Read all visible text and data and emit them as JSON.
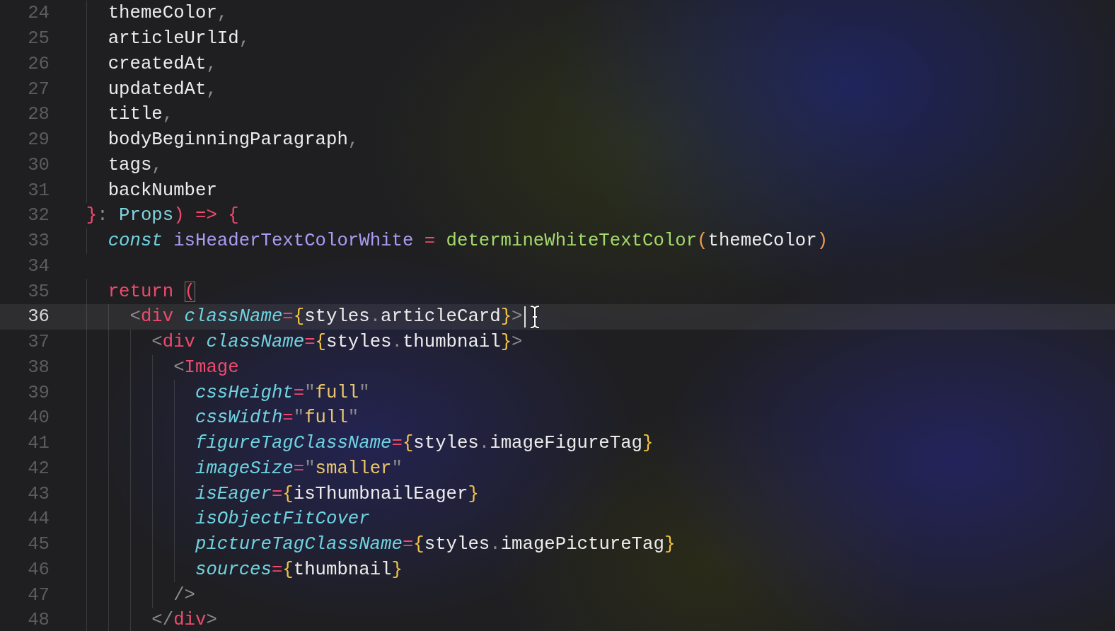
{
  "editor": {
    "lines": [
      {
        "number": "24",
        "current": false,
        "caret": false,
        "tokens": [
          {
            "text": "    themeColor",
            "kind": "plain"
          },
          {
            "text": ",",
            "kind": "punct"
          }
        ]
      },
      {
        "number": "25",
        "current": false,
        "caret": false,
        "tokens": [
          {
            "text": "    articleUrlId",
            "kind": "plain"
          },
          {
            "text": ",",
            "kind": "punct"
          }
        ]
      },
      {
        "number": "26",
        "current": false,
        "caret": false,
        "tokens": [
          {
            "text": "    createdAt",
            "kind": "plain"
          },
          {
            "text": ",",
            "kind": "punct"
          }
        ]
      },
      {
        "number": "27",
        "current": false,
        "caret": false,
        "tokens": [
          {
            "text": "    updatedAt",
            "kind": "plain"
          },
          {
            "text": ",",
            "kind": "punct"
          }
        ]
      },
      {
        "number": "28",
        "current": false,
        "caret": false,
        "tokens": [
          {
            "text": "    title",
            "kind": "plain"
          },
          {
            "text": ",",
            "kind": "punct"
          }
        ]
      },
      {
        "number": "29",
        "current": false,
        "caret": false,
        "tokens": [
          {
            "text": "    bodyBeginningParagraph",
            "kind": "plain"
          },
          {
            "text": ",",
            "kind": "punct"
          }
        ]
      },
      {
        "number": "30",
        "current": false,
        "caret": false,
        "tokens": [
          {
            "text": "    tags",
            "kind": "plain"
          },
          {
            "text": ",",
            "kind": "punct"
          }
        ]
      },
      {
        "number": "31",
        "current": false,
        "caret": false,
        "tokens": [
          {
            "text": "    backNumber",
            "kind": "plain"
          }
        ]
      },
      {
        "number": "32",
        "current": false,
        "caret": false,
        "tokens": [
          {
            "text": "  }",
            "kind": "keyword"
          },
          {
            "text": ":",
            "kind": "punct"
          },
          {
            "text": " Props",
            "kind": "type"
          },
          {
            "text": ") => {",
            "kind": "keyword"
          }
        ]
      },
      {
        "number": "33",
        "current": false,
        "caret": false,
        "tokens": [
          {
            "text": "    const",
            "kind": "storage"
          },
          {
            "text": " isHeaderTextColorWhite",
            "kind": "variable"
          },
          {
            "text": " = ",
            "kind": "keyword"
          },
          {
            "text": "determineWhiteTextColor",
            "kind": "function"
          },
          {
            "text": "(",
            "kind": "paren"
          },
          {
            "text": "themeColor",
            "kind": "plain"
          },
          {
            "text": ")",
            "kind": "paren"
          }
        ]
      },
      {
        "number": "34",
        "current": false,
        "caret": false
      },
      {
        "number": "35",
        "current": false,
        "caret": false,
        "tokens": [
          {
            "text": "    return ",
            "kind": "keyword"
          },
          {
            "text": "(",
            "kind": "match"
          }
        ]
      },
      {
        "number": "36",
        "current": true,
        "caret": true,
        "tokens": [
          {
            "text": "      <",
            "kind": "punct"
          },
          {
            "text": "div",
            "kind": "keyword"
          },
          {
            "text": " className",
            "kind": "attr"
          },
          {
            "text": "=",
            "kind": "keyword"
          },
          {
            "text": "{",
            "kind": "brace"
          },
          {
            "text": "styles",
            "kind": "plain"
          },
          {
            "text": ".",
            "kind": "punct"
          },
          {
            "text": "articleCard",
            "kind": "plain"
          },
          {
            "text": "}",
            "kind": "brace"
          },
          {
            "text": ">",
            "kind": "punct"
          }
        ]
      },
      {
        "number": "37",
        "current": false,
        "caret": false,
        "tokens": [
          {
            "text": "        <",
            "kind": "punct"
          },
          {
            "text": "div",
            "kind": "keyword"
          },
          {
            "text": " className",
            "kind": "attr"
          },
          {
            "text": "=",
            "kind": "keyword"
          },
          {
            "text": "{",
            "kind": "brace"
          },
          {
            "text": "styles",
            "kind": "plain"
          },
          {
            "text": ".",
            "kind": "punct"
          },
          {
            "text": "thumbnail",
            "kind": "plain"
          },
          {
            "text": "}",
            "kind": "brace"
          },
          {
            "text": ">",
            "kind": "punct"
          }
        ]
      },
      {
        "number": "38",
        "current": false,
        "caret": false,
        "tokens": [
          {
            "text": "          <",
            "kind": "punct"
          },
          {
            "text": "Image",
            "kind": "keyword"
          }
        ]
      },
      {
        "number": "39",
        "current": false,
        "caret": false,
        "tokens": [
          {
            "text": "            cssHeight",
            "kind": "attr"
          },
          {
            "text": "=",
            "kind": "keyword"
          },
          {
            "text": "\"",
            "kind": "punct"
          },
          {
            "text": "full",
            "kind": "string"
          },
          {
            "text": "\"",
            "kind": "punct"
          }
        ]
      },
      {
        "number": "40",
        "current": false,
        "caret": false,
        "tokens": [
          {
            "text": "            cssWidth",
            "kind": "attr"
          },
          {
            "text": "=",
            "kind": "keyword"
          },
          {
            "text": "\"",
            "kind": "punct"
          },
          {
            "text": "full",
            "kind": "string"
          },
          {
            "text": "\"",
            "kind": "punct"
          }
        ]
      },
      {
        "number": "41",
        "current": false,
        "caret": false,
        "tokens": [
          {
            "text": "            figureTagClassName",
            "kind": "attr"
          },
          {
            "text": "=",
            "kind": "keyword"
          },
          {
            "text": "{",
            "kind": "brace"
          },
          {
            "text": "styles",
            "kind": "plain"
          },
          {
            "text": ".",
            "kind": "punct"
          },
          {
            "text": "imageFigureTag",
            "kind": "plain"
          },
          {
            "text": "}",
            "kind": "brace"
          }
        ]
      },
      {
        "number": "42",
        "current": false,
        "caret": false,
        "tokens": [
          {
            "text": "            imageSize",
            "kind": "attr"
          },
          {
            "text": "=",
            "kind": "keyword"
          },
          {
            "text": "\"",
            "kind": "punct"
          },
          {
            "text": "smaller",
            "kind": "string"
          },
          {
            "text": "\"",
            "kind": "punct"
          }
        ]
      },
      {
        "number": "43",
        "current": false,
        "caret": false,
        "tokens": [
          {
            "text": "            isEager",
            "kind": "attr"
          },
          {
            "text": "=",
            "kind": "keyword"
          },
          {
            "text": "{",
            "kind": "brace"
          },
          {
            "text": "isThumbnailEager",
            "kind": "plain"
          },
          {
            "text": "}",
            "kind": "brace"
          }
        ]
      },
      {
        "number": "44",
        "current": false,
        "caret": false,
        "tokens": [
          {
            "text": "            isObjectFitCover",
            "kind": "attr"
          }
        ]
      },
      {
        "number": "45",
        "current": false,
        "caret": false,
        "tokens": [
          {
            "text": "            pictureTagClassName",
            "kind": "attr"
          },
          {
            "text": "=",
            "kind": "keyword"
          },
          {
            "text": "{",
            "kind": "brace"
          },
          {
            "text": "styles",
            "kind": "plain"
          },
          {
            "text": ".",
            "kind": "punct"
          },
          {
            "text": "imagePictureTag",
            "kind": "plain"
          },
          {
            "text": "}",
            "kind": "brace"
          }
        ]
      },
      {
        "number": "46",
        "current": false,
        "caret": false,
        "tokens": [
          {
            "text": "            sources",
            "kind": "attr"
          },
          {
            "text": "=",
            "kind": "keyword"
          },
          {
            "text": "{",
            "kind": "brace"
          },
          {
            "text": "thumbnail",
            "kind": "plain"
          },
          {
            "text": "}",
            "kind": "brace"
          }
        ]
      },
      {
        "number": "47",
        "current": false,
        "caret": false,
        "tokens": [
          {
            "text": "          />",
            "kind": "punct"
          }
        ]
      },
      {
        "number": "48",
        "current": false,
        "caret": false,
        "tokens": [
          {
            "text": "        </",
            "kind": "punct"
          },
          {
            "text": "div",
            "kind": "keyword"
          },
          {
            "text": ">",
            "kind": "punct"
          }
        ]
      }
    ]
  }
}
